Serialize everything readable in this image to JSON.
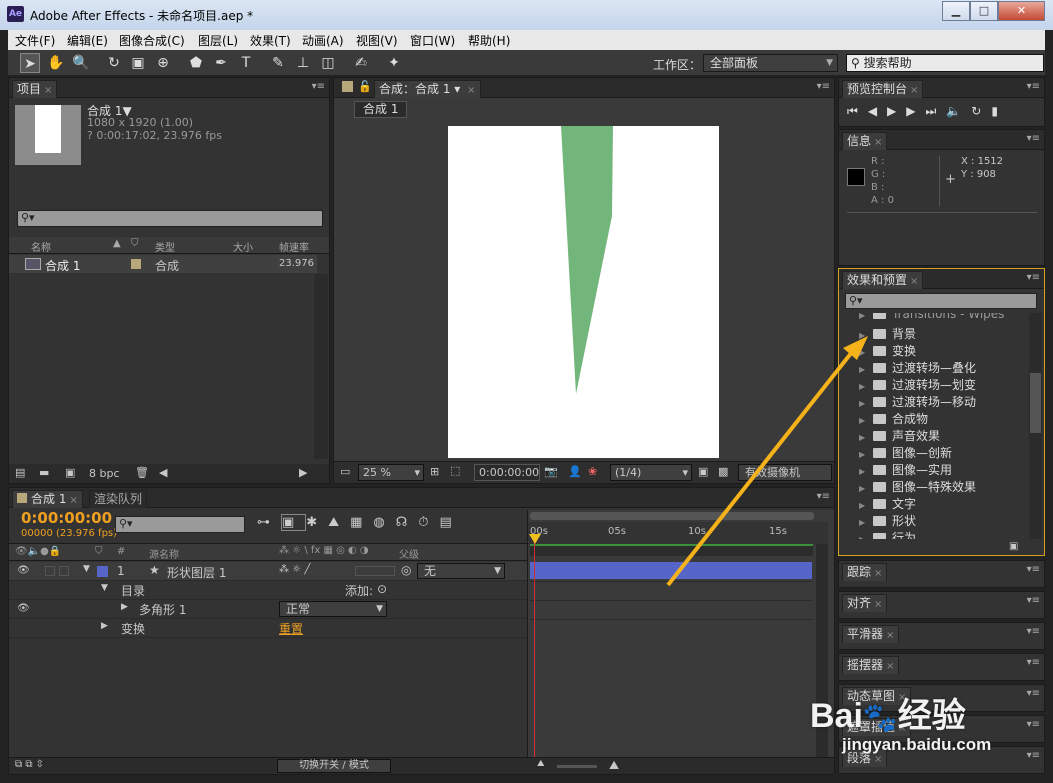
{
  "window": {
    "app_icon": "Ae",
    "title": "Adobe After Effects - 未命名项目.aep *",
    "min": "▁",
    "max": "□",
    "close": "✕"
  },
  "menu": [
    "文件(F)",
    "编辑(E)",
    "图像合成(C)",
    "图层(L)",
    "效果(T)",
    "动画(A)",
    "视图(V)",
    "窗口(W)",
    "帮助(H)"
  ],
  "workspace": {
    "label": "工作区：",
    "value": "全部面板",
    "help_placeholder": "搜索帮助"
  },
  "project": {
    "tab": "项目",
    "comp_name": "合成 1▼",
    "comp_info": [
      "1080 x 1920 (1.00)",
      "? 0:00:17:02, 23.976 fps"
    ],
    "columns": [
      "名称",
      "类型",
      "大小",
      "帧速率"
    ],
    "item": {
      "name": "合成 1",
      "type": "合成",
      "fps": "23.976"
    },
    "bpc": "8 bpc"
  },
  "comp": {
    "tab": "合成：合成 1",
    "sub_tab": "合成 1",
    "zoom": "25 %",
    "timecode": "0:00:00:00",
    "resolution": "(1/4)",
    "camera": "有效摄像机"
  },
  "preview": {
    "tab": "预览控制台"
  },
  "info": {
    "tab": "信息",
    "r": "R :",
    "g": "G :",
    "b": "B :",
    "a": "A : 0",
    "x": "X : 1512",
    "y": "Y : 908"
  },
  "effects": {
    "tab": "效果和预置",
    "items": [
      "Transitions - Wipes",
      "背景",
      "变换",
      "过渡转场—叠化",
      "过渡转场—划变",
      "过渡转场—移动",
      "合成物",
      "声音效果",
      "图像—创新",
      "图像—实用",
      "图像—特殊效果",
      "文字",
      "形状",
      "行为"
    ]
  },
  "side_panels": [
    "跟踪",
    "对齐",
    "平滑器",
    "摇摆器",
    "动态草图",
    "遮罩插值",
    "段落"
  ],
  "timeline": {
    "tabs": [
      "合成 1",
      "渲染队列"
    ],
    "timecode": "0:00:00:00",
    "frames": "00000 (23.976 fps)",
    "ruler": [
      "00s",
      "05s",
      "10s",
      "15s"
    ],
    "col_num": "#",
    "col_name": "源名称",
    "col_parent": "父级",
    "layer": {
      "num": "1",
      "name": "形状图层 1",
      "parent": "无"
    },
    "contents": "目录",
    "add": "添加:",
    "polygon": "多角形 1",
    "mode": "正常",
    "transform": "变换",
    "reset": "重置",
    "toggle": "切换开关 / 模式"
  },
  "watermark": {
    "brand": "Bai",
    "brand2": "经验",
    "url": "jingyan.baidu.com"
  },
  "colors": {
    "shape": "#73b67c",
    "accent": "#f0a020",
    "layer_bar": "#5566c8",
    "arrow": "#f5b21a"
  }
}
